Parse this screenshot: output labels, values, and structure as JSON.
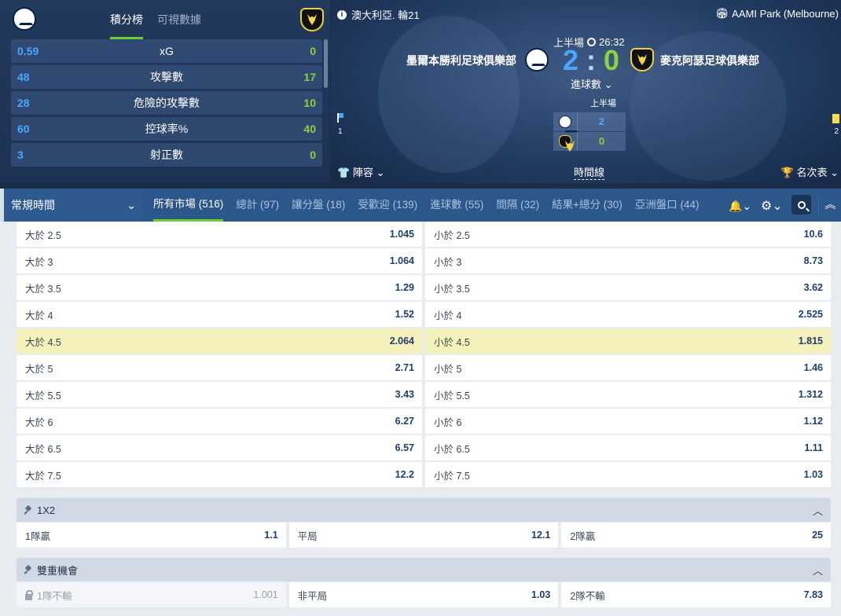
{
  "stats_panel": {
    "tabs": [
      {
        "label": "積分榜"
      },
      {
        "label": "可視數據"
      }
    ],
    "rows": [
      {
        "home": "0.59",
        "label": "xG",
        "away": "0"
      },
      {
        "home": "48",
        "label": "攻擊數",
        "away": "17"
      },
      {
        "home": "28",
        "label": "危險的攻擊數",
        "away": "10"
      },
      {
        "home": "60",
        "label": "控球率%",
        "away": "40"
      },
      {
        "home": "3",
        "label": "射正數",
        "away": "0"
      }
    ]
  },
  "match": {
    "league": "澳大利亞. 輪21",
    "venue": "AAMI Park (Melbourne)",
    "home_team": "墨爾本勝利足球俱樂部",
    "away_team": "麥克阿瑟足球俱樂部",
    "period": "上半場",
    "time": "26:32",
    "home_score": "2",
    "score_sep": ":",
    "away_score": "0",
    "stat_selector": "進球數",
    "half_label": "上半場",
    "half_home": "2",
    "half_away": "0",
    "home_flag_count": "1",
    "away_card_count": "2",
    "lineup": "陣容",
    "timeline": "時間線",
    "standings": "名次表",
    "colors": {
      "home": "#4aa8ff",
      "away": "#8bd33a"
    }
  },
  "nav": {
    "period_select": "常規時間",
    "tabs": [
      {
        "label": "所有市場 (516)"
      },
      {
        "label": "總計 (97)"
      },
      {
        "label": "讓分盤 (18)"
      },
      {
        "label": "受歡迎 (139)"
      },
      {
        "label": "進球數 (55)"
      },
      {
        "label": "間隔 (32)"
      },
      {
        "label": "結果+總分 (30)"
      },
      {
        "label": "亞洲盤口 (44)"
      }
    ],
    "icons": [
      "bell-icon",
      "gear-icon",
      "search-icon",
      "collapse-icon"
    ]
  },
  "totals": [
    {
      "over": "大於 2.5",
      "over_odds": "1.045",
      "under": "小於 2.5",
      "under_odds": "10.6"
    },
    {
      "over": "大於 3",
      "over_odds": "1.064",
      "under": "小於 3",
      "under_odds": "8.73"
    },
    {
      "over": "大於 3.5",
      "over_odds": "1.29",
      "under": "小於 3.5",
      "under_odds": "3.62"
    },
    {
      "over": "大於 4",
      "over_odds": "1.52",
      "under": "小於 4",
      "under_odds": "2.525"
    },
    {
      "over": "大於 4.5",
      "over_odds": "2.064",
      "under": "小於 4.5",
      "under_odds": "1.815"
    },
    {
      "over": "大於 5",
      "over_odds": "2.71",
      "under": "小於 5",
      "under_odds": "1.46"
    },
    {
      "over": "大於 5.5",
      "over_odds": "3.43",
      "under": "小於 5.5",
      "under_odds": "1.312"
    },
    {
      "over": "大於 6",
      "over_odds": "6.27",
      "under": "小於 6",
      "under_odds": "1.12"
    },
    {
      "over": "大於 6.5",
      "over_odds": "6.57",
      "under": "小於 6.5",
      "under_odds": "1.11"
    },
    {
      "over": "大於 7.5",
      "over_odds": "12.2",
      "under": "小於 7.5",
      "under_odds": "1.03"
    }
  ],
  "market_1x2": {
    "title": "1X2",
    "options": [
      {
        "label": "1隊贏",
        "odds": "1.1"
      },
      {
        "label": "平局",
        "odds": "12.1"
      },
      {
        "label": "2隊贏",
        "odds": "25"
      }
    ]
  },
  "market_double": {
    "title": "雙重機會",
    "options": [
      {
        "label": "1隊不輸",
        "odds": "1.001"
      },
      {
        "label": "非平局",
        "odds": "1.03"
      },
      {
        "label": "2隊不輸",
        "odds": "7.83"
      }
    ]
  }
}
